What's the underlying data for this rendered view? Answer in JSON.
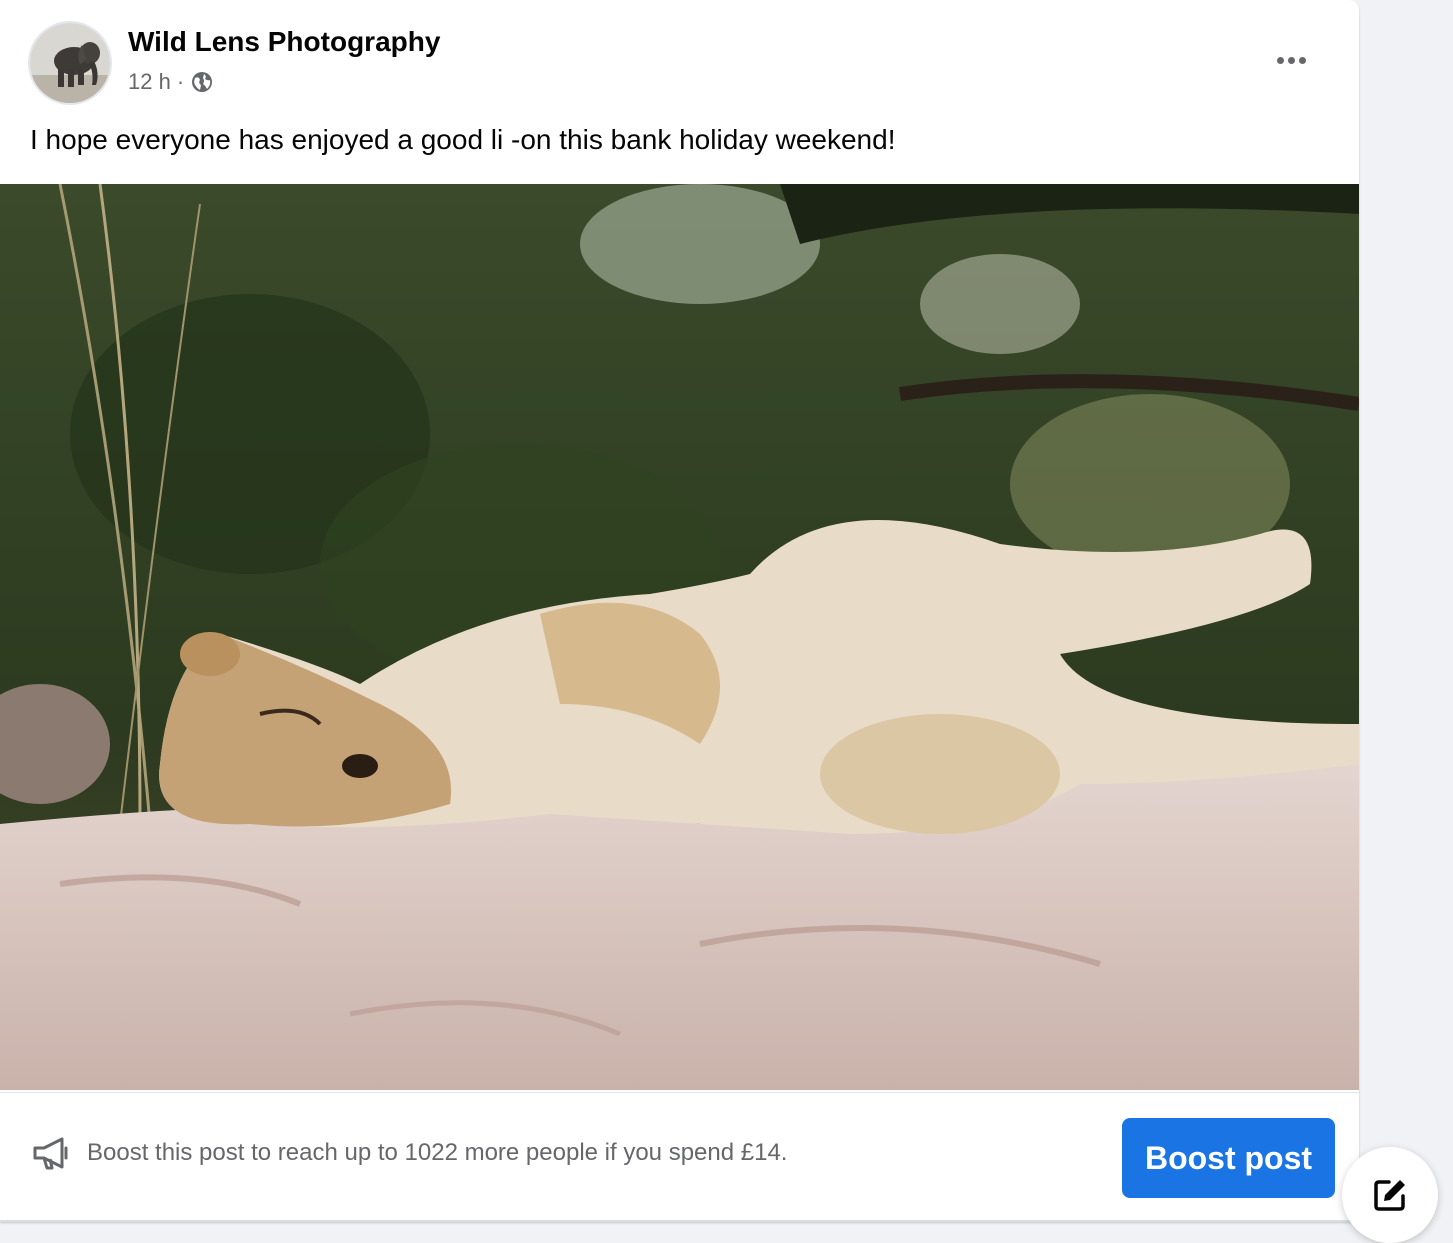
{
  "post": {
    "page_name": "Wild Lens Photography",
    "time": "12 h",
    "separator": "·",
    "privacy_icon": "globe-icon",
    "menu_icon": "more-options-icon",
    "text": "I hope everyone has enjoyed a good li -on this bank holiday weekend!"
  },
  "boost": {
    "icon": "megaphone-icon",
    "message": "Boost this post to reach up to 1022 more people if you spend £14.",
    "button_label": "Boost post"
  },
  "compose": {
    "icon": "compose-icon"
  },
  "colors": {
    "accent": "#1b74e4",
    "text_primary": "#050505",
    "text_secondary": "#65676b",
    "background": "#f0f2f5"
  }
}
